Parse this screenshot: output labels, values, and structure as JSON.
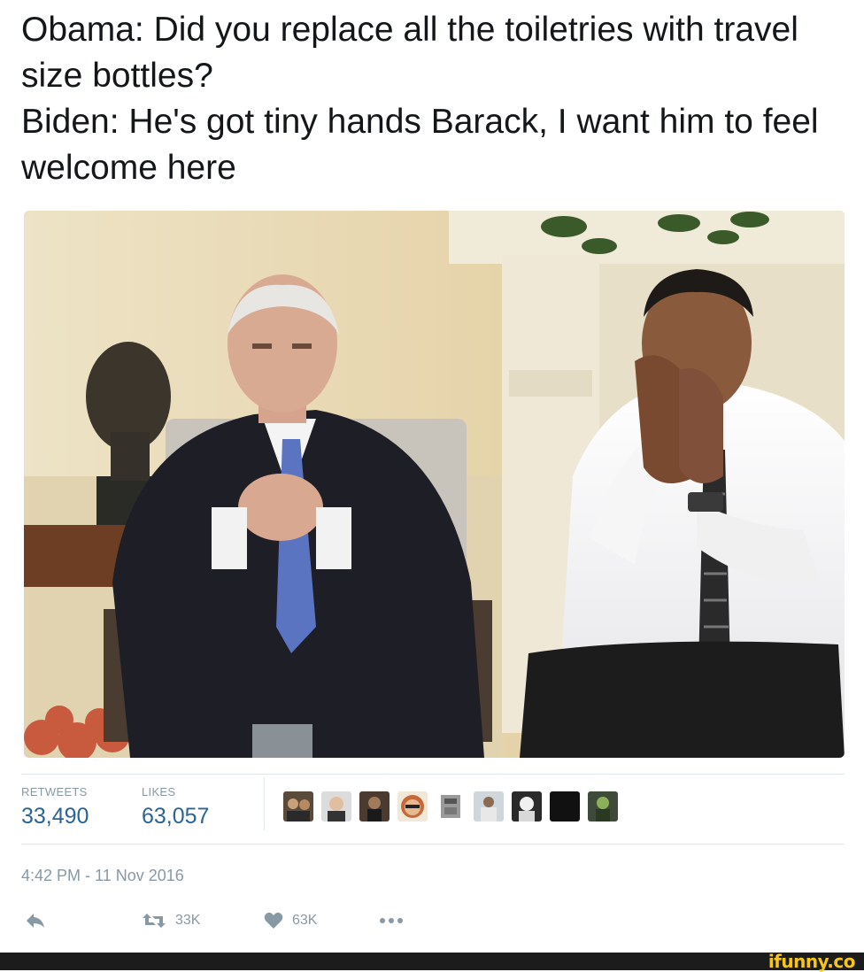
{
  "tweet": {
    "lines": [
      "Obama: Did you replace all the toiletries with travel size bottles?",
      "Biden: He's got tiny hands Barack, I want him to feel welcome here"
    ]
  },
  "stats": {
    "retweets_label": "RETWEETS",
    "retweets_value": "33,490",
    "likes_label": "LIKES",
    "likes_value": "63,057"
  },
  "timestamp": "4:42 PM - 11 Nov 2016",
  "actions": {
    "reply_icon": "reply-icon",
    "retweet_icon": "retweet-icon",
    "retweet_count": "33K",
    "like_icon": "heart-icon",
    "like_count": "63K",
    "more_icon": "more-icon"
  },
  "footer": {
    "brand": "ifunny.co"
  },
  "colors": {
    "text": "#14171a",
    "muted": "#8899a6",
    "stat_value": "#2a6496",
    "footer_bg": "#1c1c1c",
    "brand": "#f5c518"
  }
}
